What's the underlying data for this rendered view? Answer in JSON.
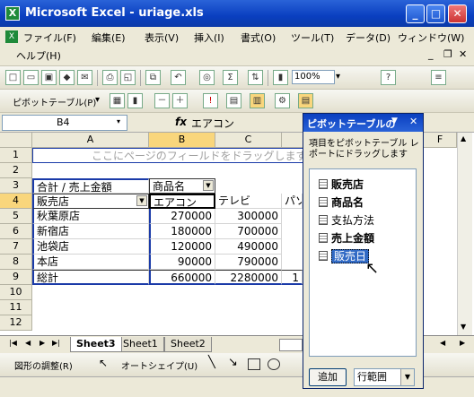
{
  "window": {
    "title": "Microsoft Excel - uriage.xls",
    "app_icon": "X"
  },
  "menu": {
    "items": [
      "ファイル(F)",
      "編集(E)",
      "表示(V)",
      "挿入(I)",
      "書式(O)",
      "ツール(T)",
      "データ(D)",
      "ウィンドウ(W)",
      "ヘルプ(H)"
    ]
  },
  "toolbar": {
    "zoom": "100%",
    "pivot_label": "ピボットテーブル(P)"
  },
  "formula_bar": {
    "name_box": "B4",
    "fx": "fx",
    "value": "エアコン"
  },
  "grid": {
    "columns": [
      "A",
      "B",
      "C",
      "D",
      "E",
      "F"
    ],
    "rows": [
      "1",
      "2",
      "3",
      "4",
      "5",
      "6",
      "7",
      "8",
      "9",
      "10",
      "11",
      "12"
    ],
    "hint": "ここにページのフィールドをドラッグします",
    "cells": {
      "r3a": "合計 / 売上金額",
      "r3b": "商品名",
      "r4a": "販売店",
      "r4b": "エアコン",
      "r4c": "テレビ",
      "r4d": "パソ",
      "r5a": "秋葉原店",
      "r5b": "270000",
      "r5c": "300000",
      "r6a": "新宿店",
      "r6b": "180000",
      "r6c": "700000",
      "r7a": "池袋店",
      "r7b": "120000",
      "r7c": "490000",
      "r8a": "本店",
      "r8b": "90000",
      "r8c": "790000",
      "r9a": "総計",
      "r9b": "660000",
      "r9c": "2280000",
      "r9d": "1"
    }
  },
  "sheets": [
    "Sheet3",
    "Sheet1",
    "Sheet2"
  ],
  "drawbar": {
    "draw_label": "図形の調整(R)",
    "autoshape_label": "オートシェイプ(U)"
  },
  "pivot_panel": {
    "title": "ピボットテーブルの",
    "description": "項目をピボットテーブル レポートにドラッグします",
    "fields": [
      {
        "label": "販売店",
        "bold": true
      },
      {
        "label": "商品名",
        "bold": true
      },
      {
        "label": "支払方法",
        "bold": false
      },
      {
        "label": "売上金額",
        "bold": true
      },
      {
        "label": "販売日",
        "bold": false,
        "selected": true
      }
    ],
    "add_button": "追加",
    "range_select": "行範囲"
  }
}
